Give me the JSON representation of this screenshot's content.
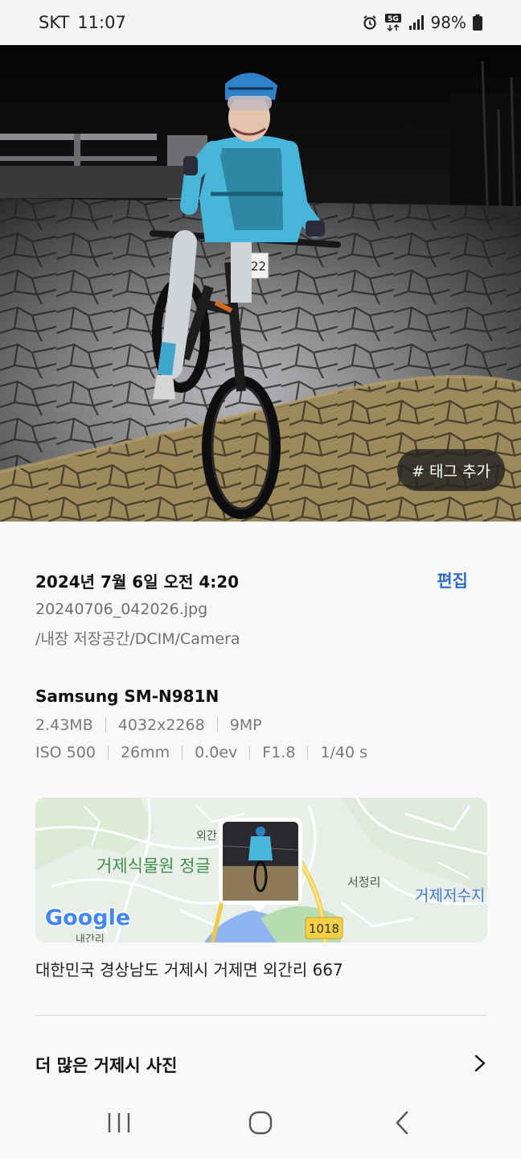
{
  "status": {
    "carrier": "SKT",
    "time": "11:07",
    "network": "5G",
    "battery": "98%",
    "icons": [
      "alarm-icon",
      "network-5g-icon",
      "signal-icon",
      "battery-icon"
    ]
  },
  "photo": {
    "bib_number": "7922",
    "tag_button_label": "# 태그 추가"
  },
  "details": {
    "datetime": "2024년 7월 6일 오전 4:20",
    "edit_label": "편집",
    "filename": "20240706_042026.jpg",
    "path": "/내장 저장공간/DCIM/Camera",
    "device": "Samsung SM-N981N",
    "meta1": [
      "2.43MB",
      "4032x2268",
      "9MP"
    ],
    "meta2": [
      "ISO 500",
      "26mm",
      "0.0ev",
      "F1.8",
      "1/40 s"
    ]
  },
  "map": {
    "labels": {
      "botanical": "거제식물원 정글",
      "seojeong": "서정리",
      "reservoir": "거제저수지",
      "oegan": "외간",
      "naegan": "내간리",
      "route": "1018"
    },
    "logo": "Google"
  },
  "address": "대한민국 경상남도 거제시 거제면 외간리 667",
  "more": {
    "label": "더 많은 거제시 사진"
  },
  "colors": {
    "accent": "#2f6ec6",
    "background": "#f8f8f8"
  }
}
